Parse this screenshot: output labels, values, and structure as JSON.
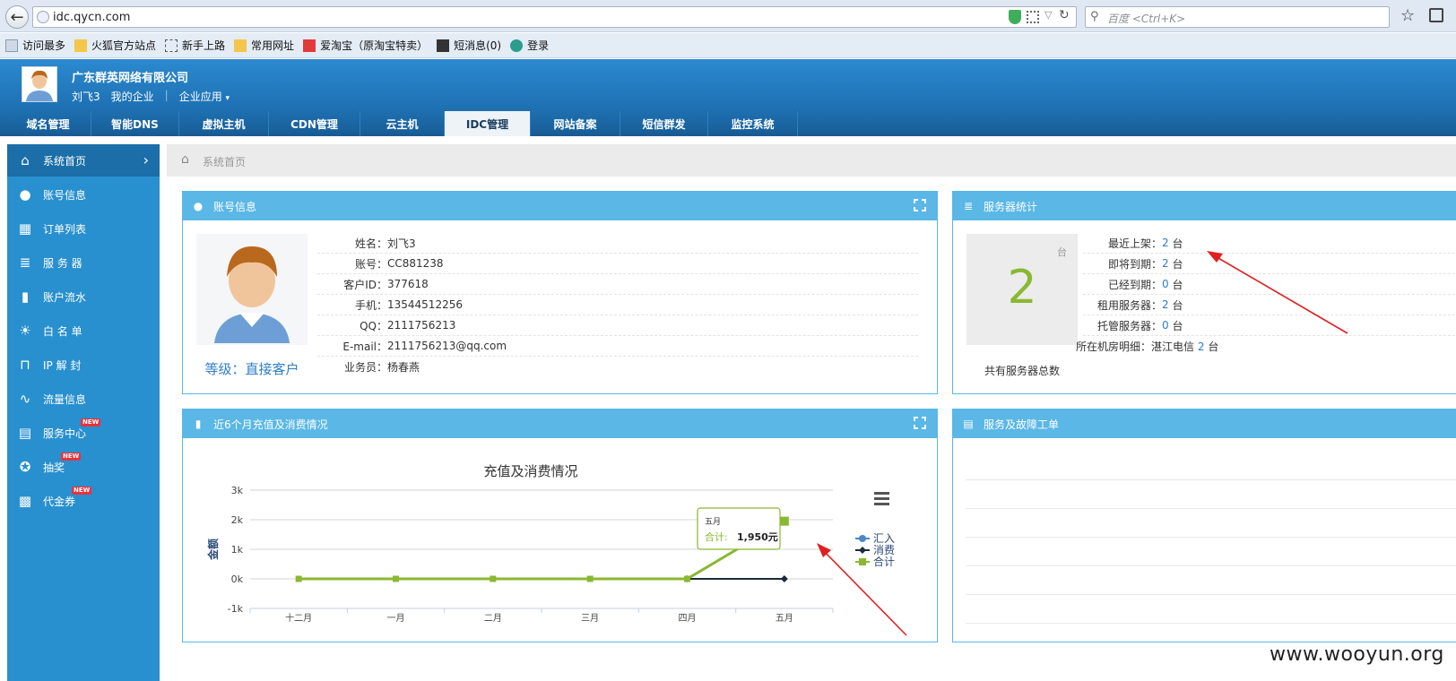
{
  "browser": {
    "url": "idc.qycn.com",
    "search_placeholder": "百度 <Ctrl+K>",
    "bookmarks": [
      "访问最多",
      "火狐官方站点",
      "新手上路",
      "常用网址",
      "爱淘宝（原淘宝特卖）",
      "短消息(0)",
      "登录"
    ]
  },
  "header": {
    "company": "广东群英网络有限公司",
    "user": "刘飞3",
    "my_enterprise": "我的企业",
    "enterprise_apps": "企业应用"
  },
  "tabs": [
    "域名管理",
    "智能DNS",
    "虚拟主机",
    "CDN管理",
    "云主机",
    "IDC管理",
    "网站备案",
    "短信群发",
    "监控系统"
  ],
  "active_tab": "IDC管理",
  "sidebar": {
    "items": [
      {
        "label": "系统首页",
        "icon": "home-icon",
        "active": true
      },
      {
        "label": "账号信息",
        "icon": "user-icon"
      },
      {
        "label": "订单列表",
        "icon": "calendar-icon"
      },
      {
        "label": "服 务 器",
        "icon": "database-icon"
      },
      {
        "label": "账户流水",
        "icon": "bar-chart-icon"
      },
      {
        "label": "白 名 单",
        "icon": "sun-icon"
      },
      {
        "label": "IP 解 封",
        "icon": "unlock-icon"
      },
      {
        "label": "流量信息",
        "icon": "pulse-icon"
      },
      {
        "label": "服务中心",
        "icon": "clipboard-icon",
        "badge": "NEW"
      },
      {
        "label": "抽奖",
        "icon": "ubuntu-icon",
        "badge": "NEW"
      },
      {
        "label": "代金券",
        "icon": "qrcode-icon",
        "badge": "NEW"
      }
    ]
  },
  "breadcrumb": "系统首页",
  "account_panel": {
    "title": "账号信息",
    "level": "等级：直接客户",
    "rows": [
      {
        "label": "姓名：",
        "value": "刘飞3"
      },
      {
        "label": "账号：",
        "value": "CC881238"
      },
      {
        "label": "客户ID：",
        "value": "377618"
      },
      {
        "label": "手机：",
        "value": "13544512256"
      },
      {
        "label": "QQ：",
        "value": "2111756213"
      },
      {
        "label": "E-mail：",
        "value": "2111756213@qq.com"
      },
      {
        "label": "业务员：",
        "value": "杨春燕"
      }
    ]
  },
  "server_panel": {
    "title": "服务器统计",
    "total": "2",
    "unit": "台",
    "total_caption": "共有服务器总数",
    "rows": [
      {
        "label": "最近上架：",
        "value": "2",
        "unit": "台"
      },
      {
        "label": "即将到期：",
        "value": "2",
        "unit": "台"
      },
      {
        "label": "已经到期：",
        "value": "0",
        "unit": "台"
      },
      {
        "label": "租用服务器：",
        "value": "2",
        "unit": "台"
      },
      {
        "label": "托管服务器：",
        "value": "0",
        "unit": "台"
      }
    ],
    "room_label": "所在机房明细：",
    "room_name": "湛江电信",
    "room_value": "2",
    "room_unit": "台"
  },
  "chart_panel": {
    "title": "近6个月充值及消费情况"
  },
  "ticket_panel": {
    "title": "服务及故障工单"
  },
  "chart_data": {
    "type": "line",
    "title": "充值及消费情况",
    "ylabel": "金额",
    "categories": [
      "十二月",
      "一月",
      "二月",
      "三月",
      "四月",
      "五月"
    ],
    "y_ticks": [
      "3k",
      "2k",
      "1k",
      "0k",
      "-1k"
    ],
    "ylim": [
      -1000,
      3000
    ],
    "series": [
      {
        "name": "汇入",
        "color": "#4a86c8",
        "values": [
          0,
          0,
          0,
          0,
          0,
          0
        ]
      },
      {
        "name": "消费",
        "color": "#1c2b3a",
        "values": [
          null,
          null,
          null,
          null,
          0,
          0
        ]
      },
      {
        "name": "合计",
        "color": "#8ab832",
        "values": [
          0,
          0,
          0,
          0,
          0,
          1950
        ]
      }
    ],
    "tooltip": {
      "title": "五月",
      "label": "合计: ",
      "value": "1,950元"
    }
  },
  "watermark": "www.wooyun.org",
  "colors": {
    "header_blue": "#2c8ad0",
    "sidebar_blue": "#2990cf",
    "panel_head": "#5ab7e6",
    "accent_green": "#8ab832",
    "arrow_red": "#e02020"
  }
}
